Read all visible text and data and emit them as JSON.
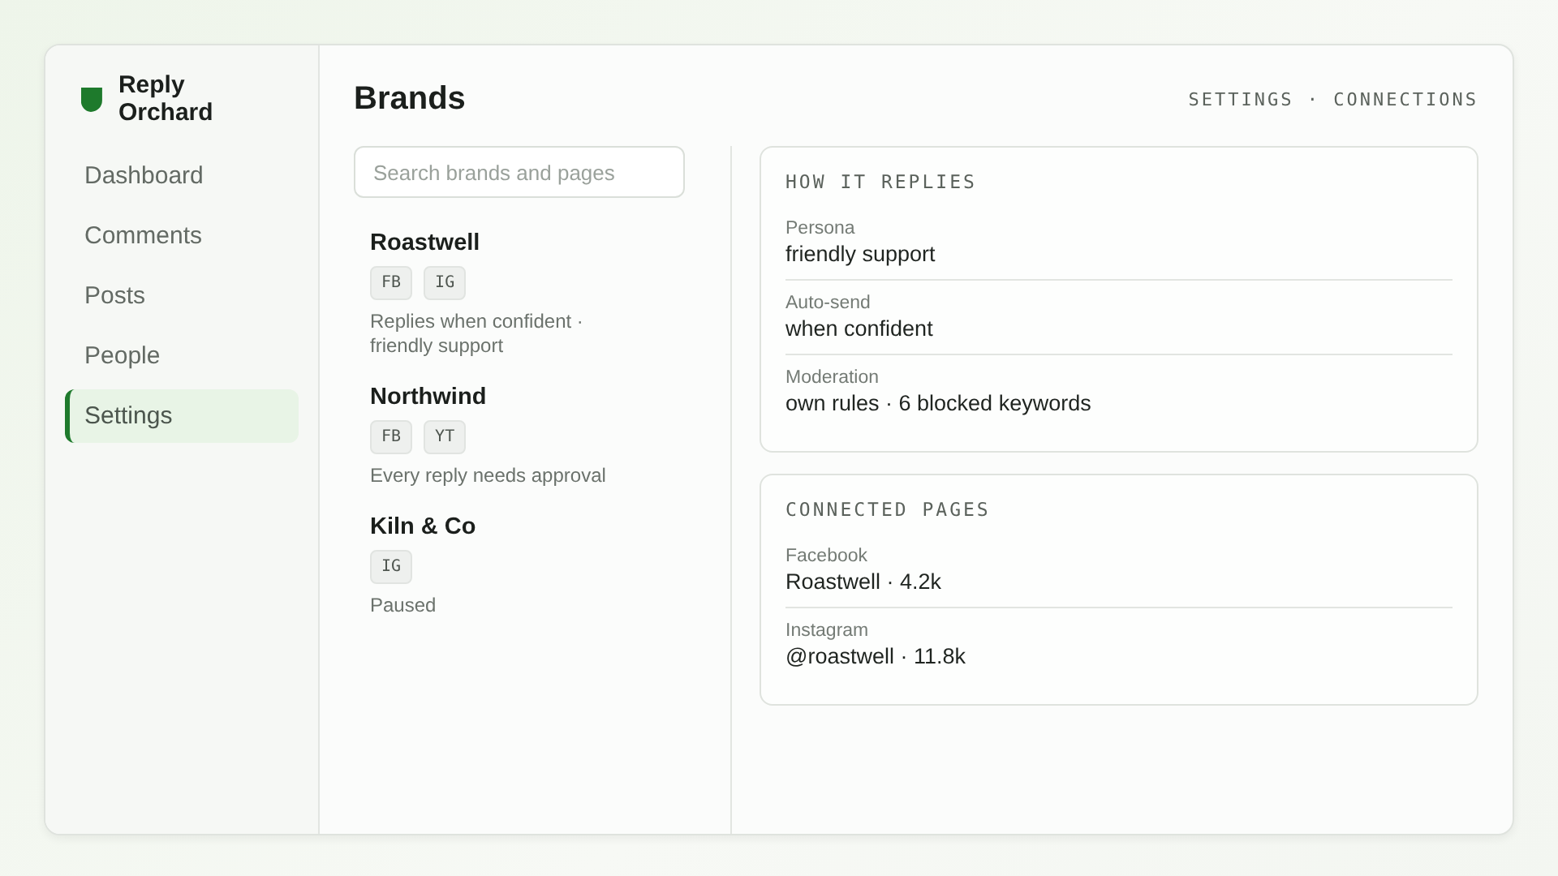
{
  "app": {
    "name": "Reply Orchard"
  },
  "nav": [
    {
      "label": "Dashboard",
      "selected": false
    },
    {
      "label": "Comments",
      "selected": false
    },
    {
      "label": "Posts",
      "selected": false
    },
    {
      "label": "People",
      "selected": false
    },
    {
      "label": "Settings",
      "selected": true
    }
  ],
  "page": {
    "title": "Brands",
    "breadcrumb": "SETTINGS · CONNECTIONS"
  },
  "search": {
    "placeholder": "Search brands and pages"
  },
  "brands": [
    {
      "name": "Roastwell",
      "tags": [
        "FB",
        "IG"
      ],
      "summary": "Replies when confident · friendly support"
    },
    {
      "name": "Northwind",
      "tags": [
        "FB",
        "YT"
      ],
      "summary": "Every reply needs approval"
    },
    {
      "name": "Kiln & Co",
      "tags": [
        "IG"
      ],
      "summary": "Paused"
    }
  ],
  "panels": [
    {
      "title": "HOW IT REPLIES",
      "fields": [
        {
          "label": "Persona",
          "value": "friendly support"
        },
        {
          "label": "Auto-send",
          "value": "when confident"
        },
        {
          "label": "Moderation",
          "value": "own rules · 6 blocked keywords"
        }
      ]
    },
    {
      "title": "CONNECTED PAGES",
      "fields": [
        {
          "label": "Facebook",
          "value": "Roastwell · 4.2k"
        },
        {
          "label": "Instagram",
          "value": "@roastwell · 11.8k"
        }
      ]
    }
  ]
}
